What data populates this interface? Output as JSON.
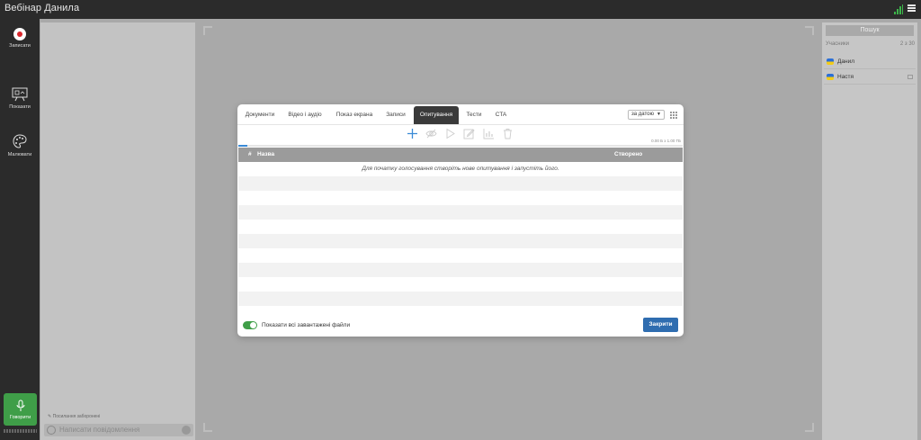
{
  "app": {
    "title": "Вебінар Данила"
  },
  "colors": {
    "accent": "#2f6db0",
    "record": "#d9262c",
    "speak": "#3f9e48",
    "signal": "#3cb34a"
  },
  "leftbar": {
    "record_label": "Записати",
    "show_label": "Показати",
    "draw_label": "Малювати",
    "speak_label": "Говорити"
  },
  "chat": {
    "note": "Посилання заборонені",
    "placeholder": "Написати повідомлення"
  },
  "participants": {
    "search_label": "Пошук",
    "header": "Учасники",
    "count": "2 з 30",
    "list": [
      {
        "name": "Данил"
      },
      {
        "name": "Настя"
      }
    ]
  },
  "modal": {
    "tabs": [
      {
        "label": "Документи"
      },
      {
        "label": "Відео і аудіо"
      },
      {
        "label": "Показ екрана"
      },
      {
        "label": "Записи"
      },
      {
        "label": "Опитування"
      },
      {
        "label": "Тести"
      },
      {
        "label": "CTA"
      }
    ],
    "active_tab": "Опитування",
    "sort_value": "за датою",
    "toolbar_icons": [
      "plus-icon",
      "eye-off-icon",
      "play-icon",
      "edit-icon",
      "chart-icon",
      "trash-icon"
    ],
    "quota": "0.00 Б з 1.00 ГБ",
    "quota_used_fraction": 0.02,
    "table": {
      "col_num": "#",
      "col_name": "Назва",
      "col_created": "Створено",
      "empty_message": "Для початку голосування створіть нове опитування і запустіть його."
    },
    "toggle_label": "Показати всі завантажені файли",
    "toggle_on": true,
    "close_label": "Закрити"
  }
}
